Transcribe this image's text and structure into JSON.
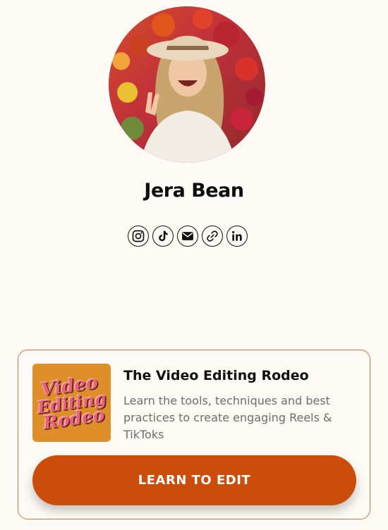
{
  "profile": {
    "name": "Jera Bean",
    "avatar_alt": "profile photo"
  },
  "socials": [
    {
      "icon": "instagram-icon"
    },
    {
      "icon": "tiktok-icon"
    },
    {
      "icon": "email-icon"
    },
    {
      "icon": "link-icon"
    },
    {
      "icon": "linkedin-icon"
    }
  ],
  "card": {
    "thumbnail_text": [
      "Video",
      "Editing",
      "Rodeo"
    ],
    "title": "The Video Editing Rodeo",
    "description": "Learn the tools, techniques and best practices to create engaging Reels & TikToks",
    "cta_label": "LEARN TO EDIT"
  },
  "colors": {
    "background": "#fdf9f4",
    "accent": "#cc4c0a",
    "card_border": "#d8743f",
    "thumbnail_bg": "#de8f2a",
    "thumbnail_text": "#ea5f7a"
  }
}
